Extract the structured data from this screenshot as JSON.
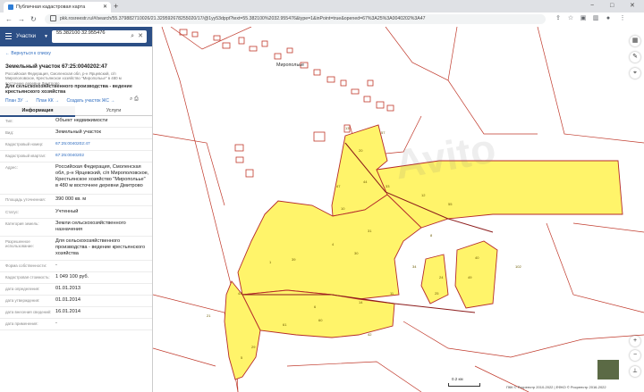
{
  "browser": {
    "tab_title": "Публичная кадастровая карта",
    "url": "pkk.rosreestr.ru/#/search/55.379882710026/21.329592678255020/17/@1yy53dppt?text=55.382100%2032.955476&type=1&inPoint=true&opened=67%3A25%3A0040202%3A47",
    "new_tab_icon": "+",
    "minimize_icon": "−",
    "maximize_icon": "□",
    "close_icon": "✕",
    "back_icon": "←",
    "forward_icon": "→",
    "reload_icon": "↻"
  },
  "search": {
    "type_label": "Участки",
    "value": "55.382100 32.955476"
  },
  "panel": {
    "back_link": "← Вернуться к списку",
    "title": "Земельный участок 67:25:0040202:47",
    "address_small": "Российская Федерация, Смоленская обл, р-н Ярцевский, с/п Мирополовское, Крестьянское хозяйство \"Миропольье\" в 480 м восточнее деревни Дмитрово",
    "purpose": "Для сельскохозяйственного производства - ведение крестьянского хозяйства",
    "links": [
      "План ЗУ →",
      "План КК →",
      "Создать участок ЖС →"
    ],
    "tabs": [
      "Информация",
      "Услуги"
    ],
    "rows": [
      {
        "label": "Тип:",
        "value": "Объект недвижимости"
      },
      {
        "label": "Вид:",
        "value": "Земельный участок"
      },
      {
        "label": "Кадастровый номер:",
        "value": "67:25:0040202:47"
      },
      {
        "label": "Кадастровый квартал:",
        "value": "67:25:0040202"
      },
      {
        "label": "Адрес:",
        "value": "Российская Федерация, Смоленская обл, р-н Ярцевский, с/п Мирополовское, Крестьянское хозяйство \"Миропольье\" в 480 м восточнее деревни Дмитрово"
      },
      {
        "label": "Площадь уточненная:",
        "value": "390 000 кв. м"
      },
      {
        "label": "Статус:",
        "value": "Учтенный"
      },
      {
        "label": "Категория земель:",
        "value": "Земли сельскохозяйственного назначения"
      },
      {
        "label": "Разрешенное использование:",
        "value": "Для сельскохозяйственного производства - ведение крестьянского хозяйства"
      },
      {
        "label": "Форма собственности:",
        "value": "-"
      },
      {
        "label": "Кадастровая стоимость:",
        "value": "1 049 100 руб."
      },
      {
        "label": "дата определения:",
        "value": "01.01.2013"
      },
      {
        "label": "дата утверждения:",
        "value": "01.01.2014"
      },
      {
        "label": "дата внесения сведений:",
        "value": "16.01.2014"
      },
      {
        "label": "дата применения:",
        "value": "-"
      }
    ]
  },
  "map": {
    "village_label": "Миропольье",
    "scale_label": "0.2 км",
    "copyright": "ПКК © Росреестр 2010-2022 | ЕФКО © Росреестр 2016-2022",
    "watermark": "Avito",
    "parcel_numbers": [
      "20",
      "44",
      "47",
      "33",
      "10",
      "31",
      "4",
      "12",
      "8",
      "55",
      "30",
      "40",
      "49",
      "24",
      "1",
      "11",
      "14",
      "6",
      "60",
      "43",
      "61",
      "5",
      "29",
      "42",
      "21",
      "39",
      "34",
      "25",
      "102",
      "57",
      "13"
    ],
    "highlight_color": "#fff46a",
    "boundary_color": "#b52a2a"
  }
}
